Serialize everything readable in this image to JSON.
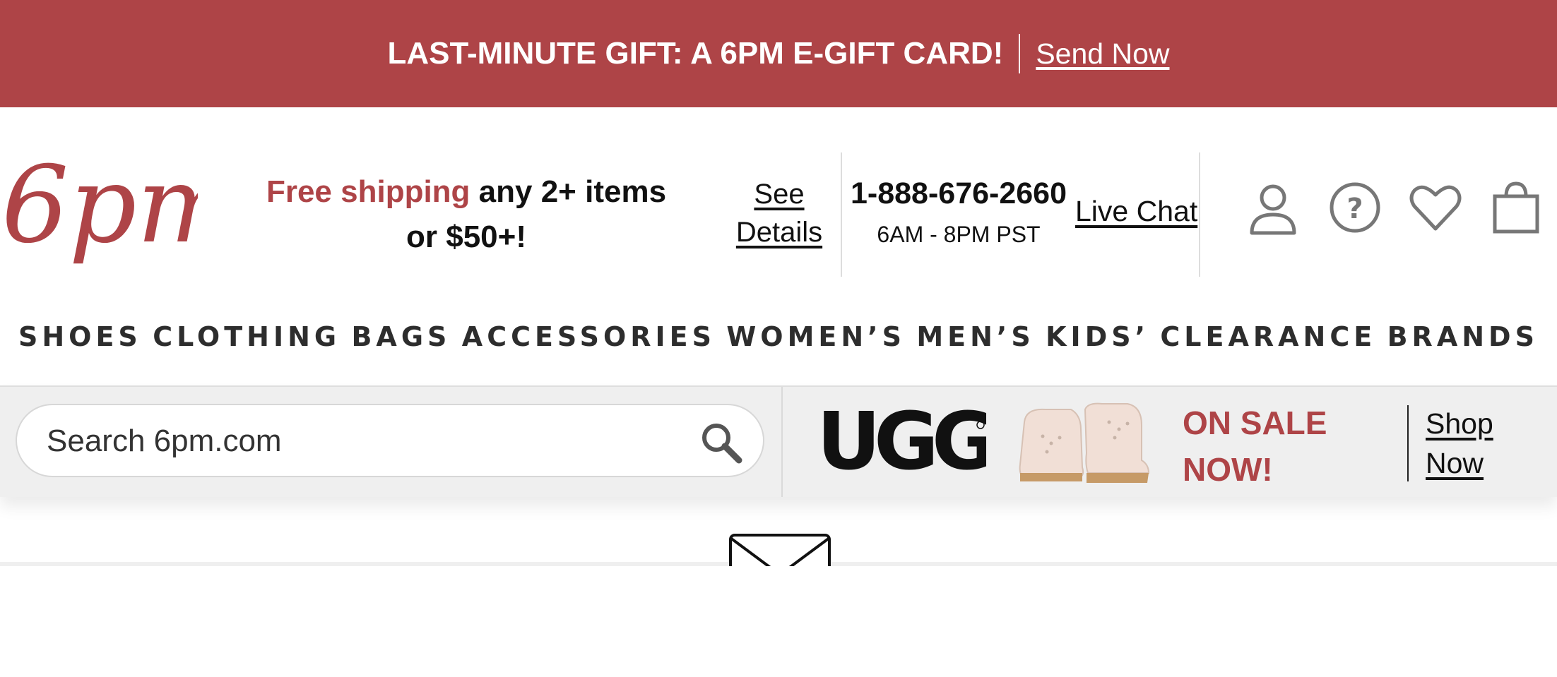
{
  "promo": {
    "text": "LAST-MINUTE GIFT: A 6PM E-GIFT CARD!",
    "link": "Send Now"
  },
  "header": {
    "logo_text": "6pm",
    "shipping_accent": "Free shipping",
    "shipping_rest": " any 2+ items or $50+!",
    "see_details": "See Details",
    "phone": "1-888-676-2660",
    "hours": "6AM - 8PM PST",
    "live_chat": "Live Chat",
    "icons": [
      "account-icon",
      "help-icon",
      "heart-icon",
      "bag-icon"
    ]
  },
  "nav": {
    "items": [
      "SHOES",
      "CLOTHING",
      "BAGS",
      "ACCESSORIES",
      "WOMEN’S",
      "MEN’S",
      "KIDS’",
      "CLEARANCE",
      "BRANDS"
    ]
  },
  "search": {
    "placeholder": "Search 6pm.com"
  },
  "promo_ugg": {
    "brand": "UGG",
    "sale_text": "ON SALE NOW!",
    "shop_now": "Shop Now"
  },
  "colors": {
    "brand_red": "#ae4447",
    "nav_text": "#2d2d2d",
    "band_bg": "#efefef"
  }
}
